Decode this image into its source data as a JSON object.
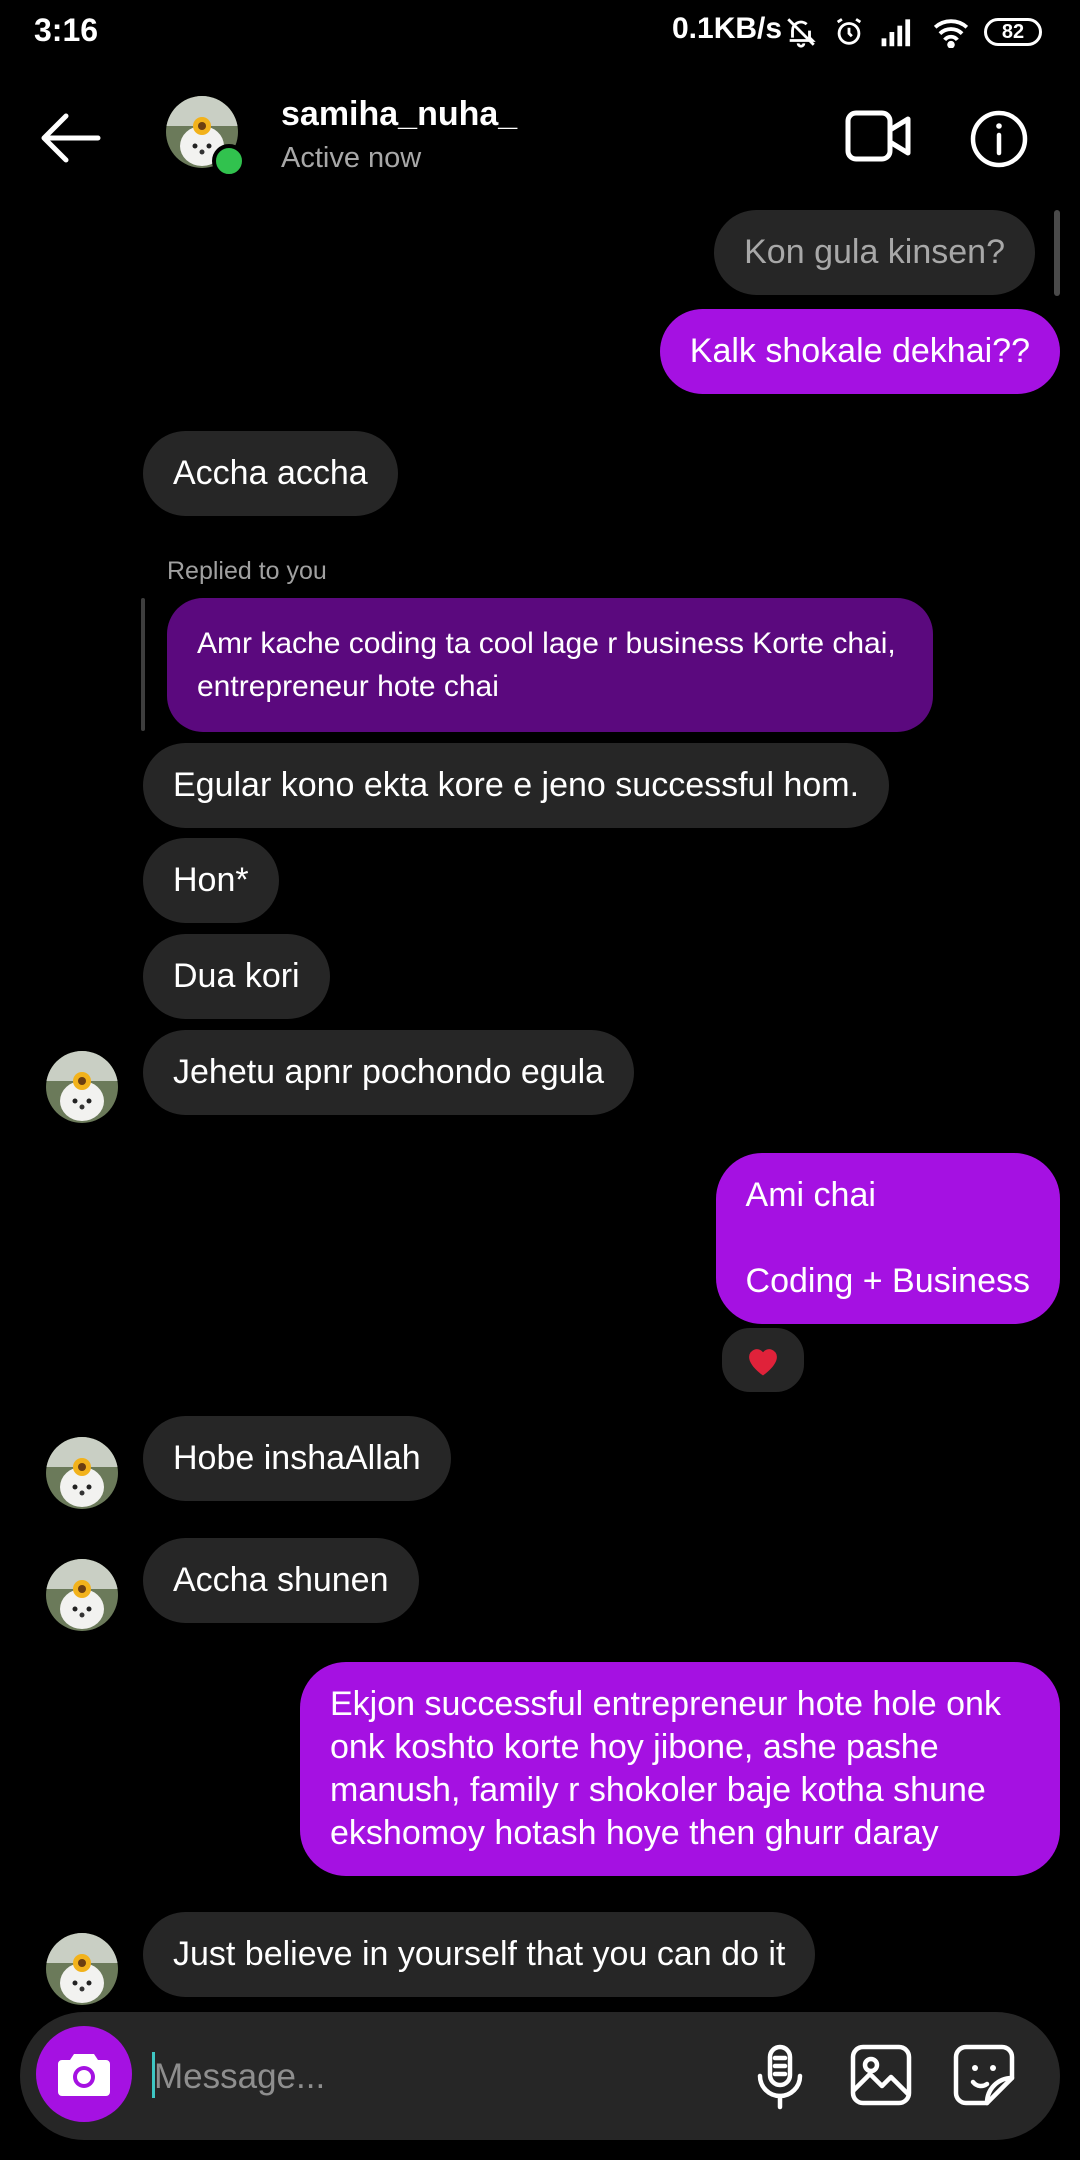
{
  "status_bar": {
    "time": "3:16",
    "net_speed": "0.1KB/s",
    "battery": "82"
  },
  "header": {
    "username": "samiha_nuha_",
    "activity": "Active now",
    "colors": {
      "online": "#31c24e"
    }
  },
  "colors": {
    "outgoing_bubble": "#a511e2",
    "incoming_bubble": "#262626",
    "reply_bubble": "#5b097e",
    "background": "#000000"
  },
  "messages": [
    {
      "from": "me",
      "text": "Kon gula kinsen?"
    },
    {
      "from": "me",
      "text": "Kalk shokale dekhai??"
    },
    {
      "from": "them",
      "text": "Accha accha"
    },
    {
      "from": "them",
      "reply_label": "Replied to you",
      "quoted": "Amr kache coding ta cool lage r business Korte chai, entrepreneur hote chai"
    },
    {
      "from": "them",
      "text": "Egular kono ekta kore e jeno successful hom."
    },
    {
      "from": "them",
      "text": "Hon*"
    },
    {
      "from": "them",
      "text": "Dua kori"
    },
    {
      "from": "them",
      "text": "Jehetu apnr pochondo egula"
    },
    {
      "from": "me",
      "text": "Ami chai\n\nCoding + Business",
      "reaction": "heart-icon"
    },
    {
      "from": "them",
      "text": "Hobe inshaAllah"
    },
    {
      "from": "them",
      "text": "Accha shunen"
    },
    {
      "from": "me",
      "text": "Ekjon successful entrepreneur hote hole onk onk koshto korte hoy jibone, ashe pashe manush, family r shokoler baje kotha shune ekshomoy hotash hoye then ghurr daray"
    },
    {
      "from": "them",
      "text": "Just believe in yourself that you can do it"
    }
  ],
  "composer": {
    "placeholder": "Message..."
  }
}
